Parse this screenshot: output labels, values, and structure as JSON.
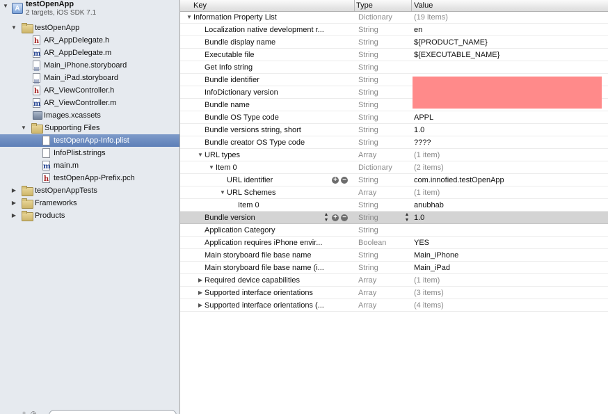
{
  "navigator": {
    "project": {
      "name": "testOpenApp",
      "subtitle": "2 targets, iOS SDK 7.1"
    },
    "items": [
      {
        "label": "testOpenApp",
        "kind": "folder",
        "expanded": true
      },
      {
        "label": "AR_AppDelegate.h",
        "kind": "h"
      },
      {
        "label": "AR_AppDelegate.m",
        "kind": "m"
      },
      {
        "label": "Main_iPhone.storyboard",
        "kind": "storyboard"
      },
      {
        "label": "Main_iPad.storyboard",
        "kind": "storyboard"
      },
      {
        "label": "AR_ViewController.h",
        "kind": "h"
      },
      {
        "label": "AR_ViewController.m",
        "kind": "m"
      },
      {
        "label": "Images.xcassets",
        "kind": "asset"
      },
      {
        "label": "Supporting Files",
        "kind": "folder",
        "expanded": true
      },
      {
        "label": "testOpenApp-Info.plist",
        "kind": "plist",
        "selected": true
      },
      {
        "label": "InfoPlist.strings",
        "kind": "strings"
      },
      {
        "label": "main.m",
        "kind": "m"
      },
      {
        "label": "testOpenApp-Prefix.pch",
        "kind": "h"
      },
      {
        "label": "testOpenAppTests",
        "kind": "folder",
        "expanded": false
      },
      {
        "label": "Frameworks",
        "kind": "folder",
        "expanded": false
      },
      {
        "label": "Products",
        "kind": "folder",
        "expanded": false
      }
    ]
  },
  "plist": {
    "columns": {
      "key": "Key",
      "type": "Type",
      "value": "Value"
    },
    "rows": [
      {
        "key": "Information Property List",
        "type": "Dictionary",
        "value": "(19 items)",
        "disclosure": "open"
      },
      {
        "key": "Localization native development r...",
        "type": "String",
        "value": "en"
      },
      {
        "key": "Bundle display name",
        "type": "String",
        "value": "${PRODUCT_NAME}"
      },
      {
        "key": "Executable file",
        "type": "String",
        "value": "${EXECUTABLE_NAME}"
      },
      {
        "key": "Get Info string",
        "type": "String",
        "value": ""
      },
      {
        "key": "Bundle identifier",
        "type": "String",
        "value": ""
      },
      {
        "key": "InfoDictionary version",
        "type": "String",
        "value": ""
      },
      {
        "key": "Bundle name",
        "type": "String",
        "value": ""
      },
      {
        "key": "Bundle OS Type code",
        "type": "String",
        "value": "APPL"
      },
      {
        "key": "Bundle versions string, short",
        "type": "String",
        "value": "1.0"
      },
      {
        "key": "Bundle creator OS Type code",
        "type": "String",
        "value": "????"
      },
      {
        "key": "URL types",
        "type": "Array",
        "value": "(1 item)",
        "disclosure": "open"
      },
      {
        "key": "Item 0",
        "type": "Dictionary",
        "value": "(2 items)",
        "disclosure": "open"
      },
      {
        "key": "URL identifier",
        "type": "String",
        "value": "com.innofied.testOpenApp"
      },
      {
        "key": "URL Schemes",
        "type": "Array",
        "value": "(1 item)",
        "disclosure": "open"
      },
      {
        "key": "Item 0",
        "type": "String",
        "value": "anubhab"
      },
      {
        "key": "Bundle version",
        "type": "String",
        "value": "1.0",
        "selected": true
      },
      {
        "key": "Application Category",
        "type": "String",
        "value": ""
      },
      {
        "key": "Application requires iPhone envir...",
        "type": "Boolean",
        "value": "YES"
      },
      {
        "key": "Main storyboard file base name",
        "type": "String",
        "value": "Main_iPhone"
      },
      {
        "key": "Main storyboard file base name (i...",
        "type": "String",
        "value": "Main_iPad"
      },
      {
        "key": "Required device capabilities",
        "type": "Array",
        "value": "(1 item)",
        "disclosure": "closed"
      },
      {
        "key": "Supported interface orientations",
        "type": "Array",
        "value": "(3 items)",
        "disclosure": "closed"
      },
      {
        "key": "Supported interface orientations (...",
        "type": "Array",
        "value": "(4 items)",
        "disclosure": "closed"
      }
    ]
  },
  "icons": {
    "disclosure_open": "▼",
    "disclosure_closed": "▶",
    "add": "+",
    "remove": "−",
    "stepper_up": "▲",
    "stepper_down": "▼"
  },
  "colors": {
    "selection_nav": "#6b8cc0",
    "selection_row": "#d4d4d4",
    "redaction": "#ff8a8a"
  }
}
